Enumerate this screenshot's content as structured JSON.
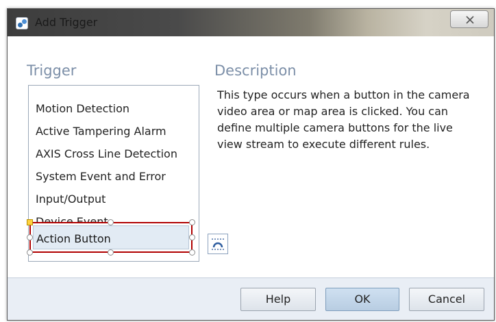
{
  "window": {
    "title": "Add Trigger",
    "close_symbol": "✕"
  },
  "trigger": {
    "heading": "Trigger",
    "items": [
      "Motion Detection",
      "Active Tampering Alarm",
      "AXIS Cross Line Detection",
      "System Event and Error",
      "Input/Output",
      "Device Event"
    ],
    "selected_item": "Action Button"
  },
  "description": {
    "heading": "Description",
    "text": "This type occurs when a button in the camera video area or map area is clicked. You can define multiple camera buttons for the live view stream to execute different rules."
  },
  "footer": {
    "help_label": "Help",
    "ok_label": "OK",
    "cancel_label": "Cancel"
  },
  "icons": {
    "app": "app-camera-icon",
    "close": "close-icon",
    "busy": "busy-cursor-icon",
    "layout": "layout-options-icon"
  },
  "colors": {
    "heading": "#7c8fa8",
    "selection_border": "#b00000",
    "selection_fill": "#e2ebf4",
    "footer_bg": "#e9eef5"
  }
}
